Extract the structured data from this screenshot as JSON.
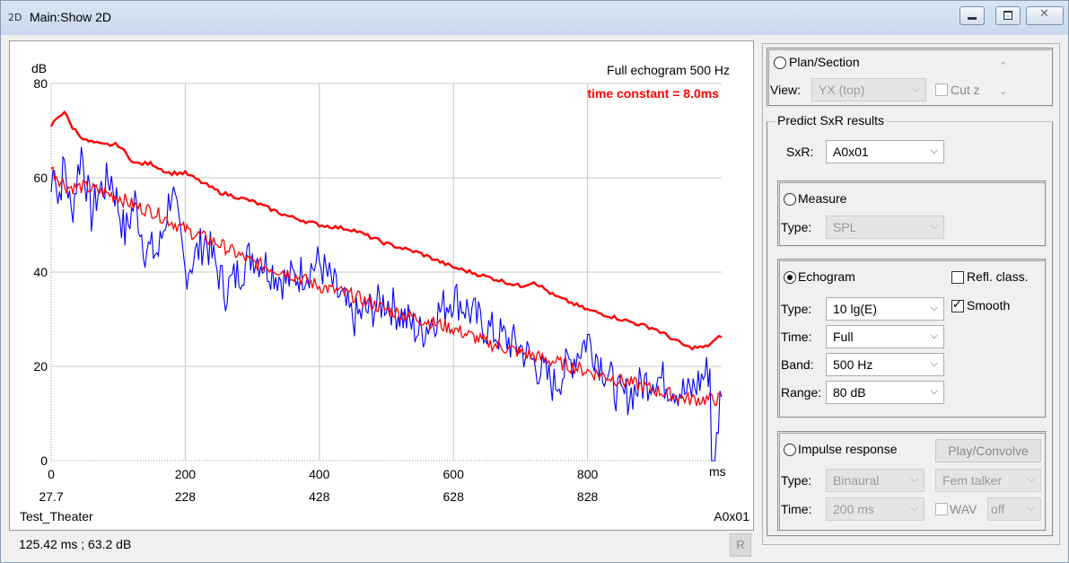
{
  "window": {
    "icon_text": "2D",
    "title": "Main:Show 2D"
  },
  "plot": {
    "title": "Full echogram 500 Hz",
    "subtitle": "time constant = 8.0ms",
    "y_unit": "dB",
    "x_unit": "ms",
    "bottom_left_label": "Test_Theater",
    "bottom_right_label": "A0x01",
    "y_ticks": [
      "80",
      "60",
      "40",
      "20",
      "0"
    ],
    "x_ticks": [
      "0",
      "200",
      "400",
      "600",
      "800"
    ],
    "x_ticks_secondary": [
      "27.7",
      "228",
      "428",
      "628",
      "828"
    ]
  },
  "chart_data": {
    "type": "line",
    "title": "Full echogram 500 Hz",
    "subtitle": "time constant = 8.0ms",
    "xlabel": "ms",
    "ylabel": "dB",
    "xlim": [
      0,
      1000
    ],
    "ylim": [
      0,
      80
    ],
    "grid": true,
    "series": [
      {
        "color": "#ff0000",
        "x": [
          0,
          10,
          20,
          30,
          50,
          75,
          100,
          125,
          150,
          175,
          200,
          250,
          300,
          350,
          400,
          450,
          500,
          550,
          600,
          650,
          700,
          720,
          750,
          800,
          850,
          900,
          950,
          975,
          1000
        ],
        "y": [
          71,
          73,
          74,
          71,
          68,
          67,
          67,
          63,
          63,
          61,
          61,
          57,
          55,
          52,
          50,
          49,
          46,
          44,
          41,
          39,
          37,
          38,
          35,
          32,
          30,
          28,
          24,
          24,
          26.5
        ]
      },
      {
        "color": "#ff0000",
        "x": [
          0,
          10,
          25,
          50,
          75,
          100,
          125,
          150,
          175,
          200,
          250,
          300,
          350,
          400,
          450,
          500,
          550,
          600,
          650,
          700,
          750,
          800,
          850,
          900,
          950,
          1000
        ],
        "y": [
          62,
          60,
          58,
          58,
          57,
          56,
          54,
          53,
          51,
          49,
          46,
          42,
          40,
          37,
          35,
          32,
          30,
          28,
          25,
          23,
          21,
          19,
          17,
          15,
          13,
          13
        ]
      },
      {
        "color": "#0000ff",
        "x": [
          0,
          5,
          10,
          20,
          30,
          45,
          60,
          70,
          90,
          110,
          125,
          140,
          160,
          180,
          200,
          230,
          260,
          300,
          350,
          400,
          450,
          500,
          550,
          600,
          650,
          700,
          750,
          800,
          850,
          900,
          950,
          985,
          990,
          1000
        ],
        "y": [
          57,
          65,
          55,
          63,
          52,
          66,
          52,
          57,
          60,
          48,
          55,
          45,
          44,
          58,
          40,
          47,
          36,
          44,
          38,
          42,
          30,
          34,
          27,
          35,
          28,
          24,
          16,
          26,
          13,
          18,
          14,
          20,
          0,
          17
        ]
      }
    ]
  },
  "status": {
    "readout": "125.42 ms ; 63.2 dB",
    "r_button": "R"
  },
  "panel": {
    "plan_section": {
      "radio_label": "Plan/Section",
      "view_label": "View:",
      "view_value": "YX (top)",
      "cutz_label": "Cut z"
    },
    "predict": {
      "group_title": "Predict SxR results",
      "sxr_label": "SxR:",
      "sxr_value": "A0x01"
    },
    "measure": {
      "radio_label": "Measure",
      "type_label": "Type:",
      "type_value": "SPL"
    },
    "echogram": {
      "radio_label": "Echogram",
      "refl_label": "Refl. class.",
      "smooth_label": "Smooth",
      "type_label": "Type:",
      "type_value": "10 lg(E)",
      "time_label": "Time:",
      "time_value": "Full",
      "band_label": "Band:",
      "band_value": "500 Hz",
      "range_label": "Range:",
      "range_value": "80 dB"
    },
    "impulse": {
      "radio_label": "Impulse response",
      "play_button": "Play/Convolve",
      "type_label": "Type:",
      "type_value": "Binaural",
      "talker_value": "Fem talker",
      "time_label": "Time:",
      "time_value": "200 ms",
      "wav_label": "WAV",
      "wav_value": "off"
    }
  }
}
